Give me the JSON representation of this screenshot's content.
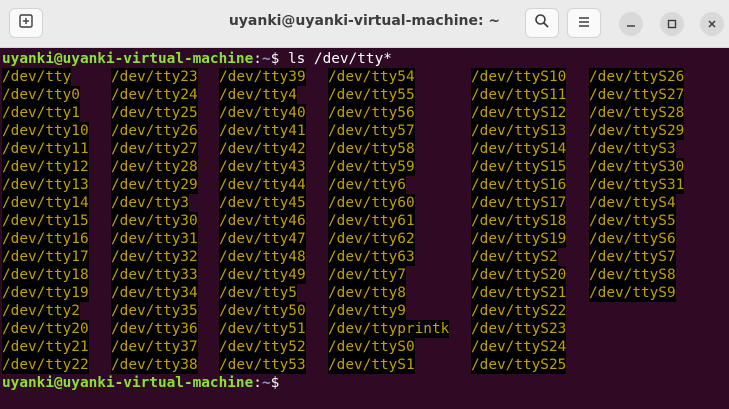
{
  "window": {
    "title": "uyanki@uyanki-virtual-machine: ~"
  },
  "prompt": {
    "user_host": "uyanki@uyanki-virtual-machine",
    "sep": ":",
    "path": "~",
    "symbol": "$"
  },
  "command": " ls /dev/tty*",
  "columns": [
    [
      "/dev/tty",
      "/dev/tty0",
      "/dev/tty1",
      "/dev/tty10",
      "/dev/tty11",
      "/dev/tty12",
      "/dev/tty13",
      "/dev/tty14",
      "/dev/tty15",
      "/dev/tty16",
      "/dev/tty17",
      "/dev/tty18",
      "/dev/tty19",
      "/dev/tty2",
      "/dev/tty20",
      "/dev/tty21",
      "/dev/tty22"
    ],
    [
      "/dev/tty23",
      "/dev/tty24",
      "/dev/tty25",
      "/dev/tty26",
      "/dev/tty27",
      "/dev/tty28",
      "/dev/tty29",
      "/dev/tty3",
      "/dev/tty30",
      "/dev/tty31",
      "/dev/tty32",
      "/dev/tty33",
      "/dev/tty34",
      "/dev/tty35",
      "/dev/tty36",
      "/dev/tty37",
      "/dev/tty38"
    ],
    [
      "/dev/tty39",
      "/dev/tty4",
      "/dev/tty40",
      "/dev/tty41",
      "/dev/tty42",
      "/dev/tty43",
      "/dev/tty44",
      "/dev/tty45",
      "/dev/tty46",
      "/dev/tty47",
      "/dev/tty48",
      "/dev/tty49",
      "/dev/tty5",
      "/dev/tty50",
      "/dev/tty51",
      "/dev/tty52",
      "/dev/tty53"
    ],
    [
      "/dev/tty54",
      "/dev/tty55",
      "/dev/tty56",
      "/dev/tty57",
      "/dev/tty58",
      "/dev/tty59",
      "/dev/tty6",
      "/dev/tty60",
      "/dev/tty61",
      "/dev/tty62",
      "/dev/tty63",
      "/dev/tty7",
      "/dev/tty8",
      "/dev/tty9",
      "/dev/ttyprintk",
      "/dev/ttyS0",
      "/dev/ttyS1"
    ],
    [
      "/dev/ttyS10",
      "/dev/ttyS11",
      "/dev/ttyS12",
      "/dev/ttyS13",
      "/dev/ttyS14",
      "/dev/ttyS15",
      "/dev/ttyS16",
      "/dev/ttyS17",
      "/dev/ttyS18",
      "/dev/ttyS19",
      "/dev/ttyS2",
      "/dev/ttyS20",
      "/dev/ttyS21",
      "/dev/ttyS22",
      "/dev/ttyS23",
      "/dev/ttyS24",
      "/dev/ttyS25"
    ],
    [
      "/dev/ttyS26",
      "/dev/ttyS27",
      "/dev/ttyS28",
      "/dev/ttyS29",
      "/dev/ttyS3",
      "/dev/ttyS30",
      "/dev/ttyS31",
      "/dev/ttyS4",
      "/dev/ttyS5",
      "/dev/ttyS6",
      "/dev/ttyS7",
      "/dev/ttyS8",
      "/dev/ttyS9"
    ]
  ],
  "icons": {
    "new_tab": "new-tab-icon",
    "search": "search-icon",
    "menu": "hamburger-menu-icon",
    "minimize": "minimize-icon",
    "maximize": "maximize-icon",
    "close": "close-icon"
  },
  "colors": {
    "terminal_bg": "#300a24",
    "user": "#8ae234",
    "path": "#729fcf",
    "listing_text": "#c4a000",
    "listing_bg": "#000000"
  }
}
